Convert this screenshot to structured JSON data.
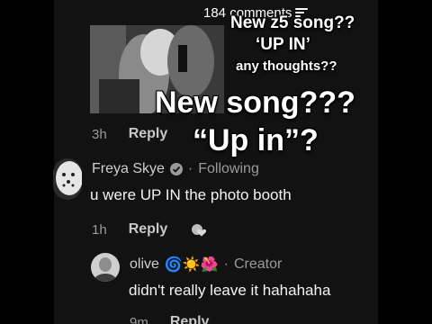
{
  "header": {
    "comment_count": "184 comments"
  },
  "comments": [
    {
      "time": "3h",
      "reply_label": "Reply"
    },
    {
      "username": "Freya Skye",
      "relation": "Following",
      "separator": "·",
      "text": "u were UP IN the photo booth",
      "time": "1h",
      "reply_label": "Reply"
    },
    {
      "username": "olive",
      "badge": "Creator",
      "separator": "·",
      "emoji": "🌀☀️🌺",
      "text": "didn't really leave it hahahaha",
      "time": "9m",
      "reply_label": "Reply"
    }
  ],
  "overlay": {
    "top_line1": "New z5 song??",
    "top_line2": "‘UP IN’",
    "top_line3": "any thoughts??",
    "big_line1": "New song???",
    "big_line2": "“Up in”?"
  },
  "colors": {
    "background": "#000000",
    "panel": "#121212",
    "muted": "#9a9a9a",
    "text": "#f2f2f2"
  }
}
